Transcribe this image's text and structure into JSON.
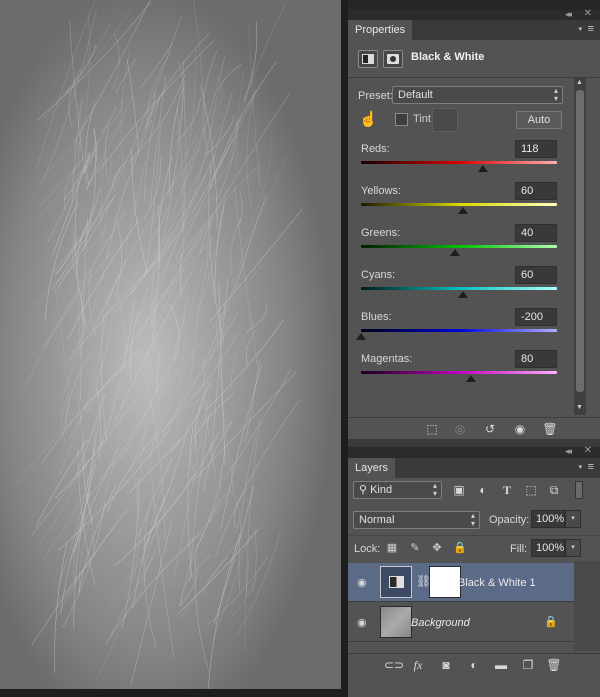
{
  "properties": {
    "tab_label": "Properties",
    "adjustment_title": "Black & White",
    "preset_label": "Preset:",
    "preset_value": "Default",
    "tint_label": "Tint",
    "auto_label": "Auto",
    "sliders": [
      {
        "label": "Reds:",
        "value": "118",
        "gradient": [
          "#1a0000",
          "#d80000",
          "#ffb0b0"
        ],
        "position": 0.62
      },
      {
        "label": "Yellows:",
        "value": "60",
        "gradient": [
          "#1a1a00",
          "#d8d800",
          "#ffffc0"
        ],
        "position": 0.52
      },
      {
        "label": "Greens:",
        "value": "40",
        "gradient": [
          "#001a00",
          "#00c000",
          "#b0ffb0"
        ],
        "position": 0.48
      },
      {
        "label": "Cyans:",
        "value": "60",
        "gradient": [
          "#001a1a",
          "#00c0c0",
          "#b0ffff"
        ],
        "position": 0.52
      },
      {
        "label": "Blues:",
        "value": "-200",
        "gradient": [
          "#00001a",
          "#0000d8",
          "#b0b0ff"
        ],
        "position": 0.0
      },
      {
        "label": "Magentas:",
        "value": "80",
        "gradient": [
          "#1a001a",
          "#c000c0",
          "#ffb0ff"
        ],
        "position": 0.56
      }
    ],
    "footer_icons": [
      "clip-to-layer-icon",
      "view-previous-icon",
      "reset-icon",
      "visibility-icon",
      "trash-icon"
    ]
  },
  "layers": {
    "tab_label": "Layers",
    "filter_value": "Kind",
    "blend_mode": "Normal",
    "opacity_label": "Opacity:",
    "opacity_value": "100%",
    "lock_label": "Lock:",
    "fill_label": "Fill:",
    "fill_value": "100%",
    "items": [
      {
        "name": "Black & White 1",
        "selected": true
      },
      {
        "name": "Background",
        "selected": false,
        "locked": true
      }
    ],
    "footer_icons": [
      "link-layers-icon",
      "fx-icon",
      "add-mask-icon",
      "new-adjustment-icon",
      "new-group-icon",
      "new-layer-icon",
      "delete-layer-icon"
    ]
  },
  "colors": {
    "panel_bg": "#535353",
    "selected_layer": "#5b6a87",
    "canvas_gray": "#7e7e7e"
  }
}
